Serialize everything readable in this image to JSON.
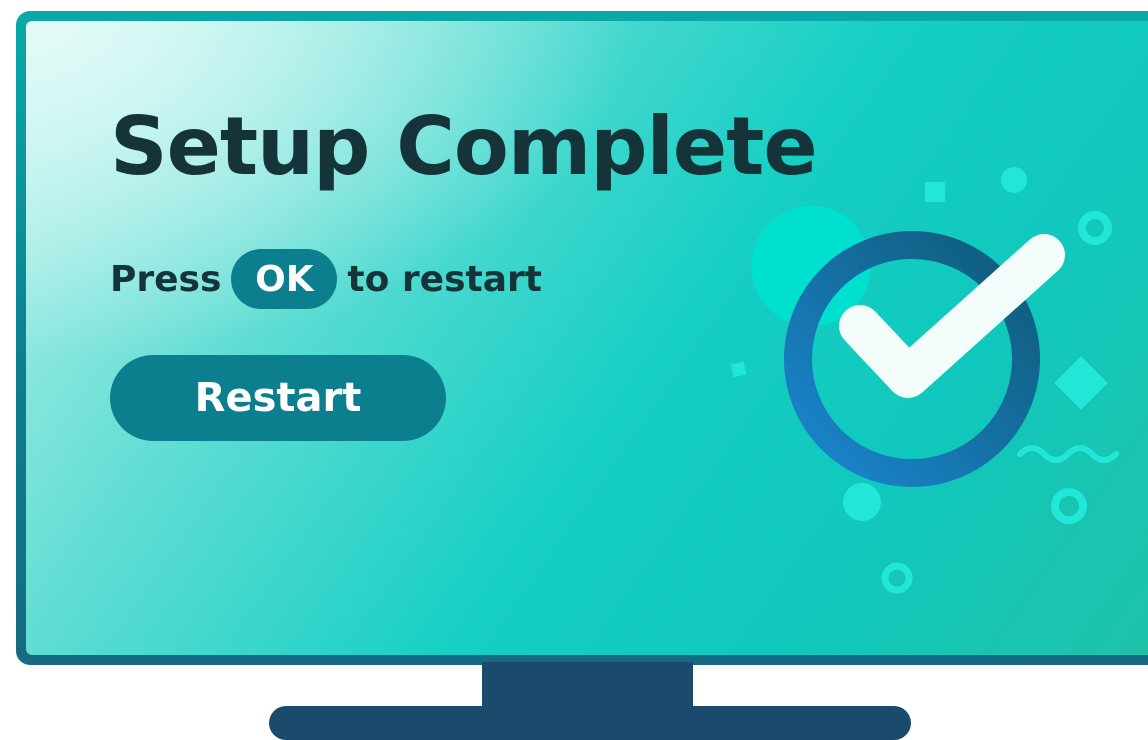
{
  "screen": {
    "title": "Setup Complete",
    "instruction": {
      "prefix": "Press",
      "key_label": "OK",
      "suffix": "to restart"
    },
    "restart_button_label": "Restart"
  },
  "icons": [
    "checkmark-circle-icon"
  ],
  "colors": {
    "title_text": "#15343a",
    "button_fill": "#0b7f8d",
    "button_text": "#ffffff",
    "check_ring": "#1766a8",
    "tv_stand": "#1a4b6d"
  }
}
